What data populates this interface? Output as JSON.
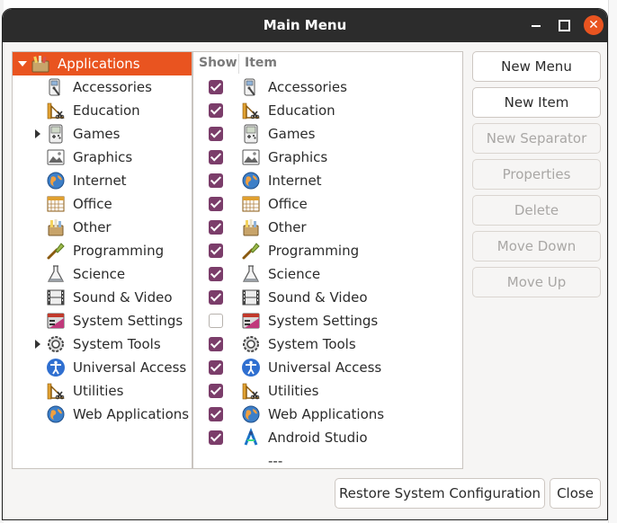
{
  "window": {
    "title": "Main Menu"
  },
  "titlebar_buttons": {
    "minimize": "minimize",
    "maximize": "maximize",
    "close": "✕"
  },
  "tree": {
    "root": {
      "label": "Applications",
      "icon": "applications-folder-icon",
      "expanded": true,
      "selected": true
    },
    "items": [
      {
        "label": "Accessories",
        "icon": "accessories-icon",
        "has_children": false
      },
      {
        "label": "Education",
        "icon": "education-icon",
        "has_children": false
      },
      {
        "label": "Games",
        "icon": "games-icon",
        "has_children": true
      },
      {
        "label": "Graphics",
        "icon": "graphics-icon",
        "has_children": false
      },
      {
        "label": "Internet",
        "icon": "internet-icon",
        "has_children": false
      },
      {
        "label": "Office",
        "icon": "office-icon",
        "has_children": false
      },
      {
        "label": "Other",
        "icon": "other-icon",
        "has_children": false
      },
      {
        "label": "Programming",
        "icon": "programming-icon",
        "has_children": false
      },
      {
        "label": "Science",
        "icon": "science-icon",
        "has_children": false
      },
      {
        "label": "Sound & Video",
        "icon": "sound-video-icon",
        "has_children": false
      },
      {
        "label": "System Settings",
        "icon": "system-settings-icon",
        "has_children": false
      },
      {
        "label": "System Tools",
        "icon": "system-tools-icon",
        "has_children": true
      },
      {
        "label": "Universal Access",
        "icon": "universal-access-icon",
        "has_children": false
      },
      {
        "label": "Utilities",
        "icon": "utilities-icon",
        "has_children": false
      },
      {
        "label": "Web Applications",
        "icon": "web-applications-icon",
        "has_children": false
      }
    ]
  },
  "items_table": {
    "headers": {
      "show": "Show",
      "item": "Item"
    },
    "rows": [
      {
        "label": "Accessories",
        "icon": "accessories-icon",
        "checked": true
      },
      {
        "label": "Education",
        "icon": "education-icon",
        "checked": true
      },
      {
        "label": "Games",
        "icon": "games-icon",
        "checked": true
      },
      {
        "label": "Graphics",
        "icon": "graphics-icon",
        "checked": true
      },
      {
        "label": "Internet",
        "icon": "internet-icon",
        "checked": true
      },
      {
        "label": "Office",
        "icon": "office-icon",
        "checked": true
      },
      {
        "label": "Other",
        "icon": "other-icon",
        "checked": true
      },
      {
        "label": "Programming",
        "icon": "programming-icon",
        "checked": true
      },
      {
        "label": "Science",
        "icon": "science-icon",
        "checked": true
      },
      {
        "label": "Sound & Video",
        "icon": "sound-video-icon",
        "checked": true
      },
      {
        "label": "System Settings",
        "icon": "system-settings-icon",
        "checked": false
      },
      {
        "label": "System Tools",
        "icon": "system-tools-icon",
        "checked": true
      },
      {
        "label": "Universal Access",
        "icon": "universal-access-icon",
        "checked": true
      },
      {
        "label": "Utilities",
        "icon": "utilities-icon",
        "checked": true
      },
      {
        "label": "Web Applications",
        "icon": "web-applications-icon",
        "checked": true
      },
      {
        "label": "Android Studio",
        "icon": "android-studio-icon",
        "checked": true
      },
      {
        "label": "---",
        "icon": "",
        "checked": null
      }
    ]
  },
  "side_buttons": {
    "new_menu": "New Menu",
    "new_item": "New Item",
    "new_separator": "New Separator",
    "properties": "Properties",
    "delete": "Delete",
    "move_down": "Move Down",
    "move_up": "Move Up"
  },
  "bottom_buttons": {
    "restore": "Restore System Configuration",
    "close": "Close"
  },
  "colors": {
    "accent": "#e95420",
    "checkbox": "#7b3d6a",
    "titlebar": "#2c2c2c"
  }
}
